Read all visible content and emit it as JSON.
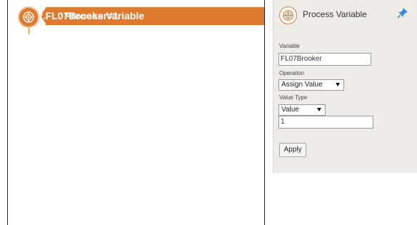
{
  "canvas": {
    "node": {
      "title": "Process Variable",
      "value": "f.FL07Brooker=1",
      "icon": "process-variable-icon",
      "color": "#e07a2e"
    }
  },
  "panel": {
    "title": "Process Variable",
    "icon": "process-variable-icon",
    "pin_icon": "pin-icon",
    "variable_label": "Variable",
    "variable_value": "FL07Brooker",
    "operation_label": "Operation",
    "operation_value": "Assign Value",
    "value_type_label": "Value Type",
    "value_type_value": "Value",
    "value_value": "1",
    "apply_label": "Apply"
  }
}
